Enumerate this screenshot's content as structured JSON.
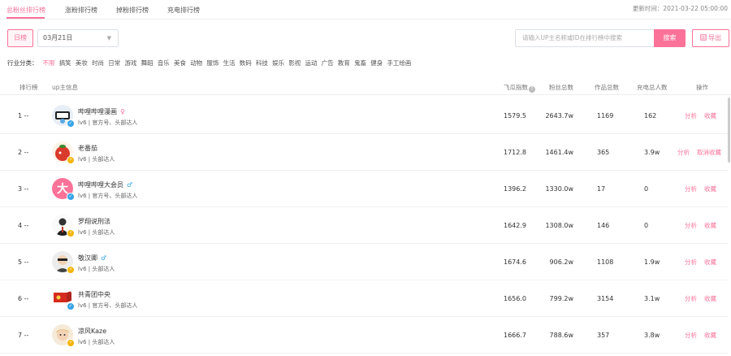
{
  "tabs": [
    "总粉丝排行榜",
    "涨粉排行榜",
    "掉粉排行榜",
    "充电排行榜"
  ],
  "update_time": "更新时间：2021-03-22 05:00:00",
  "filters": {
    "period_button": "日榜",
    "date_value": "03月21日",
    "search_placeholder": "请输入UP主名称或ID在排行榜中搜索",
    "search_button": "搜索",
    "export_button": "导出"
  },
  "categories": {
    "label": "行业分类：",
    "items": [
      "不限",
      "搞笑",
      "美妆",
      "时尚",
      "日常",
      "游戏",
      "舞蹈",
      "音乐",
      "美食",
      "动物",
      "服饰",
      "生活",
      "数码",
      "科技",
      "娱乐",
      "影视",
      "运动",
      "广告",
      "教育",
      "鬼畜",
      "健身",
      "手工绘画"
    ],
    "selected": "不限"
  },
  "table": {
    "headers": {
      "rank": "排行榜",
      "info": "up主信息",
      "feigua": "飞瓜指数",
      "fans": "粉丝总数",
      "works": "作品总数",
      "charge": "充电总人数",
      "ops": "操作"
    },
    "rows": [
      {
        "rank": "1",
        "change": "--",
        "name": "哔哩哔哩漫画",
        "gender": "♀",
        "gender_type": "f",
        "tags": "lv6 | 官方号、头部达人",
        "feigua": "1579.5",
        "fans": "2643.7w",
        "works": "1169",
        "charge": "162",
        "op1": "分析",
        "op2": "收藏",
        "badge": "blue"
      },
      {
        "rank": "2",
        "change": "--",
        "name": "老番茄",
        "gender": "",
        "gender_type": "",
        "tags": "lv6 | 头部达人",
        "feigua": "1712.8",
        "fans": "1461.4w",
        "works": "365",
        "charge": "3.9w",
        "op1": "分析",
        "op2": "取消收藏",
        "badge": "gold"
      },
      {
        "rank": "3",
        "change": "--",
        "name": "哔哩哔哩大会员",
        "gender": "♂",
        "gender_type": "m",
        "tags": "lv6 | 官方号、头部达人",
        "feigua": "1396.2",
        "fans": "1330.0w",
        "works": "17",
        "charge": "0",
        "op1": "分析",
        "op2": "收藏",
        "badge": "blue"
      },
      {
        "rank": "4",
        "change": "--",
        "name": "罗翔说刑法",
        "gender": "",
        "gender_type": "",
        "tags": "lv6 | 头部达人",
        "feigua": "1642.9",
        "fans": "1308.0w",
        "works": "146",
        "charge": "0",
        "op1": "分析",
        "op2": "收藏",
        "badge": "gold"
      },
      {
        "rank": "5",
        "change": "--",
        "name": "敬汉卿",
        "gender": "♂",
        "gender_type": "m",
        "tags": "lv6 | 头部达人",
        "feigua": "1674.6",
        "fans": "906.2w",
        "works": "1108",
        "charge": "1.9w",
        "op1": "分析",
        "op2": "收藏",
        "badge": "gold"
      },
      {
        "rank": "6",
        "change": "--",
        "name": "共青团中央",
        "gender": "",
        "gender_type": "",
        "tags": "lv6 | 官方号、头部达人",
        "feigua": "1656.0",
        "fans": "799.2w",
        "works": "3154",
        "charge": "3.1w",
        "op1": "分析",
        "op2": "收藏",
        "badge": "blue"
      },
      {
        "rank": "7",
        "change": "--",
        "name": "凉风Kaze",
        "gender": "",
        "gender_type": "",
        "tags": "lv6 | 头部达人",
        "feigua": "1666.7",
        "fans": "788.6w",
        "works": "357",
        "charge": "3.8w",
        "op1": "分析",
        "op2": "收藏",
        "badge": "gold"
      }
    ]
  },
  "colors": {
    "accent": "#fb7299",
    "blue": "#35a3e6",
    "gold": "#f5b400"
  }
}
